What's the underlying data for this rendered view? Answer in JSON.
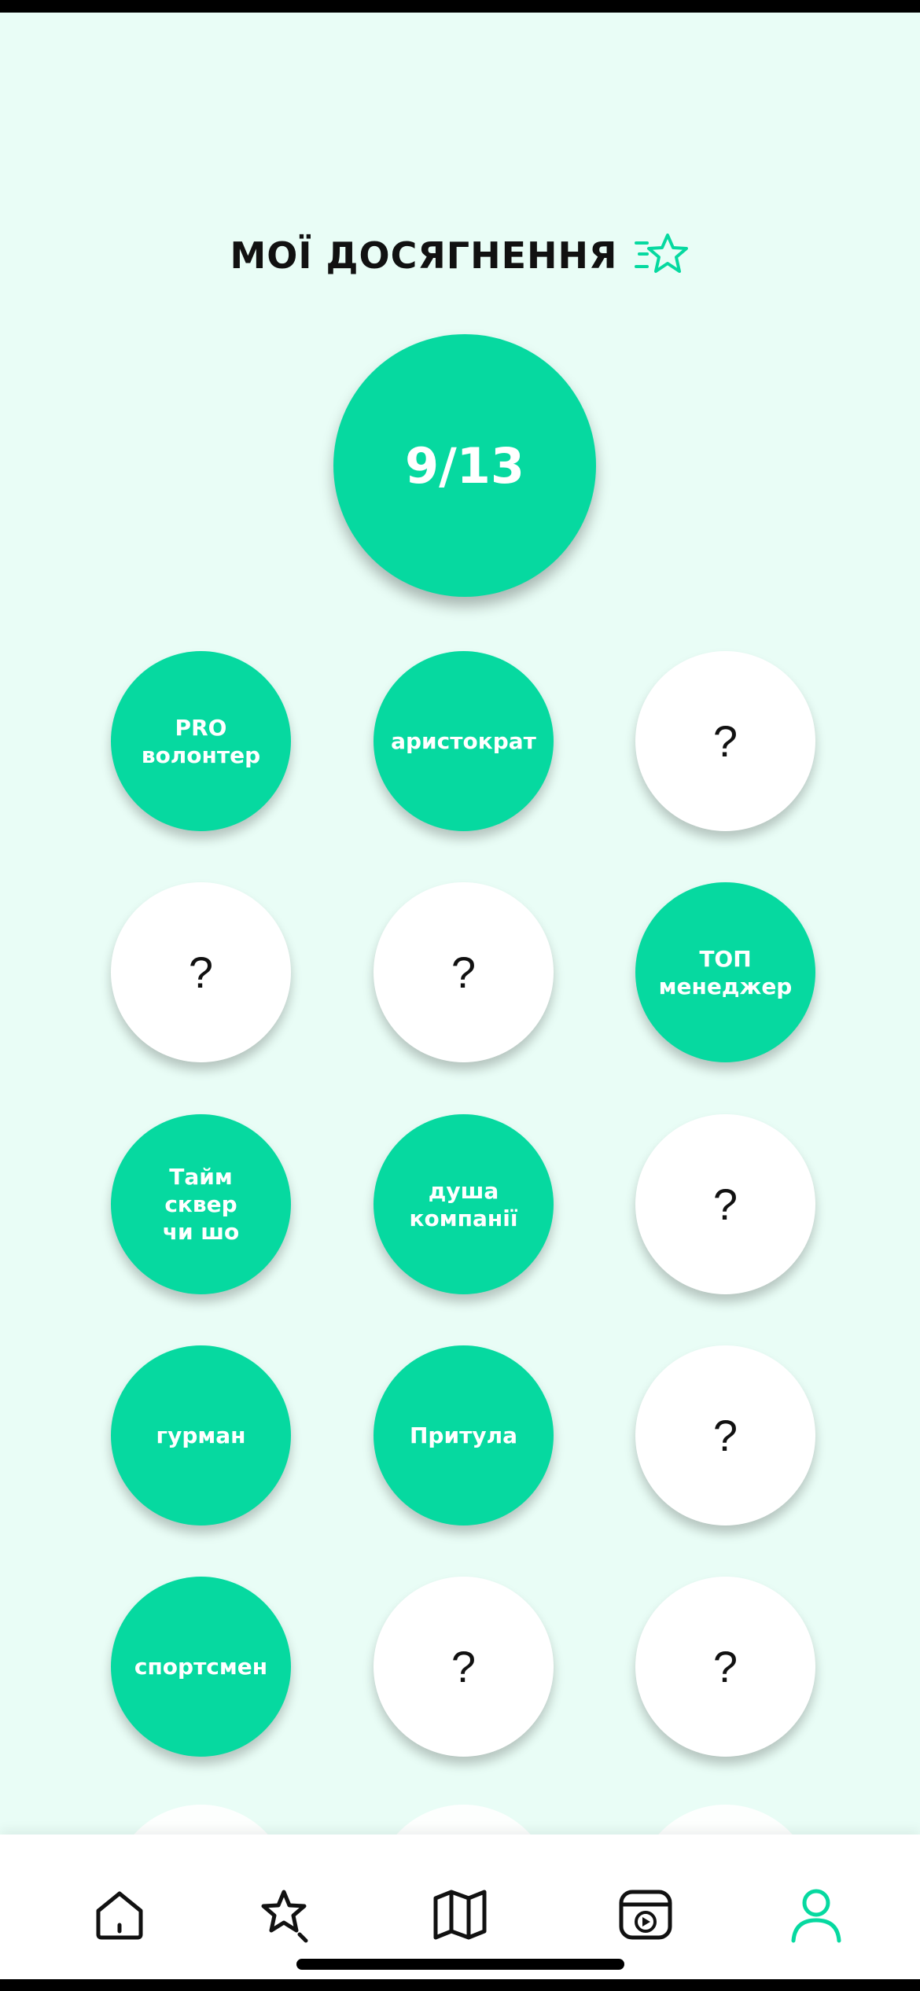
{
  "header": {
    "title": "МОЇ ДОСЯГНЕННЯ",
    "icon": "star-achievement-icon"
  },
  "progress": {
    "label": "9/13",
    "earned": 9,
    "total": 13
  },
  "achievements": [
    {
      "label": "PRO\nволонтер",
      "earned": true
    },
    {
      "label": "аристократ",
      "earned": true
    },
    {
      "label": "?",
      "earned": false
    },
    {
      "label": "?",
      "earned": false
    },
    {
      "label": "?",
      "earned": false
    },
    {
      "label": "ТОП\nменеджер",
      "earned": true
    },
    {
      "label": "Тайм\nсквер\nчи шо",
      "earned": true
    },
    {
      "label": "душа\nкомпанії",
      "earned": true
    },
    {
      "label": "?",
      "earned": false
    },
    {
      "label": "гурман",
      "earned": true
    },
    {
      "label": "Притула",
      "earned": true
    },
    {
      "label": "?",
      "earned": false
    },
    {
      "label": "спортсмен",
      "earned": true
    },
    {
      "label": "?",
      "earned": false
    },
    {
      "label": "?",
      "earned": false
    }
  ],
  "tabbar": {
    "tabs": [
      {
        "name": "home-icon",
        "active": false
      },
      {
        "name": "star-search-icon",
        "active": false
      },
      {
        "name": "map-icon",
        "active": false
      },
      {
        "name": "video-icon",
        "active": false
      },
      {
        "name": "profile-icon",
        "active": true
      }
    ]
  },
  "colors": {
    "accent": "#06d9a0",
    "background": "#e9fdf6",
    "locked": "#ffffff",
    "text": "#111111"
  }
}
